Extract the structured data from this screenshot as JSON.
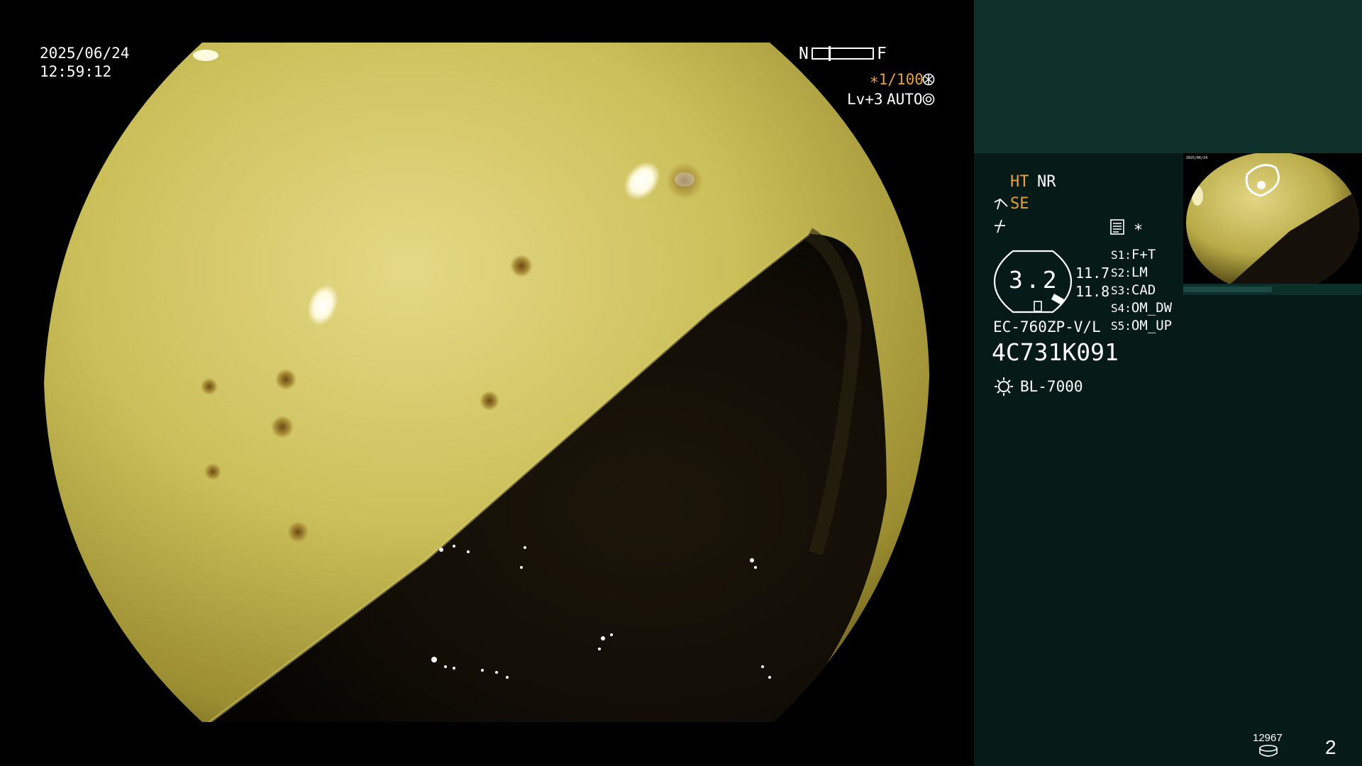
{
  "overlay": {
    "date": "2025/06/24",
    "time": "12:59:12",
    "focus_near": "N",
    "focus_far": "F",
    "shutter": "∗1/100",
    "shutter_icon": "shutter-icon",
    "level": "Lv+3",
    "iris_mode": "AUTO",
    "iris_icon": "iris-icon"
  },
  "panel": {
    "ht": "HT",
    "nr": "NR",
    "se": "SE",
    "se_icon": "pen-icon",
    "bolt_icon": "bolt-icon",
    "memo_icon": "memo-icon",
    "asterisk": "∗",
    "zoom_value": "3.2",
    "value_a": "11.7",
    "value_b": "11.8",
    "scope_model": "EC-760ZP-V/L",
    "scope_serial": "4C731K091",
    "light_source": "BL-7000",
    "light_icon": "lightbulb-icon",
    "switches": [
      {
        "key": "S1",
        "value": "F+T"
      },
      {
        "key": "S2",
        "value": "LM"
      },
      {
        "key": "S3",
        "value": "CAD"
      },
      {
        "key": "S4",
        "value": "OM_DW"
      },
      {
        "key": "S5",
        "value": "OM_UP"
      }
    ],
    "storage_count": "12967",
    "storage_icon": "storage-icon",
    "page_number": "2"
  },
  "colors": {
    "panel_bg": "#061a17",
    "panel_header_bg": "#0e312c",
    "accent": "#e8a23a",
    "mucosa": "#c9bf55"
  }
}
